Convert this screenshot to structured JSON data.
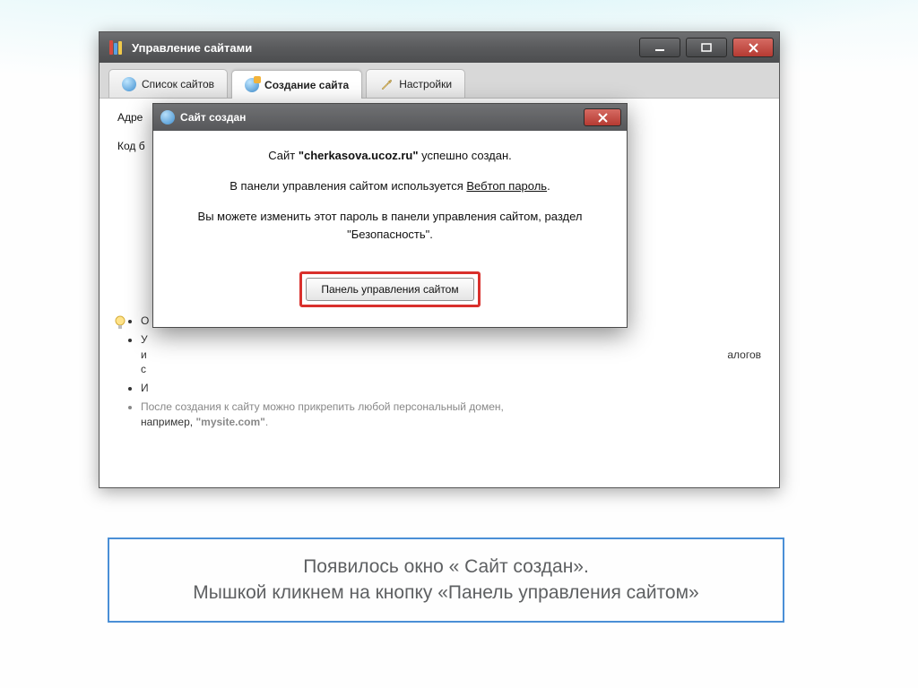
{
  "app": {
    "title": "Управление сайтами",
    "tabs": [
      {
        "label": "Список сайтов",
        "active": false
      },
      {
        "label": "Создание сайта",
        "active": true
      },
      {
        "label": "Настройки",
        "active": false
      }
    ],
    "form": {
      "address_label": "Адре",
      "code_label": "Код б"
    },
    "hints": {
      "item1_pre": "О",
      "item2_pre": "У",
      "item2_cont_a": "и",
      "item2_cont_b": "алогов",
      "item2_cont_c": "с",
      "item3_pre": "И",
      "item4_post": "например, ",
      "item4_bold": "\"mysite.com\"",
      "item4_end": "."
    }
  },
  "dialog": {
    "title": "Сайт создан",
    "line1_pre": "Сайт ",
    "line1_site": "\"cherkasova.ucoz.ru\"",
    "line1_post": " успешно создан.",
    "line2_pre": "В панели управления сайтом используется ",
    "line2_link": "Вебтоп пароль",
    "line2_post": ".",
    "line3": "Вы можете изменить этот пароль в панели управления сайтом, раздел \"Безопасность\".",
    "button": "Панель управления сайтом"
  },
  "caption": {
    "line1": "Появилось окно « Сайт создан».",
    "line2": "Мышкой кликнем на кнопку «Панель управления сайтом»"
  }
}
